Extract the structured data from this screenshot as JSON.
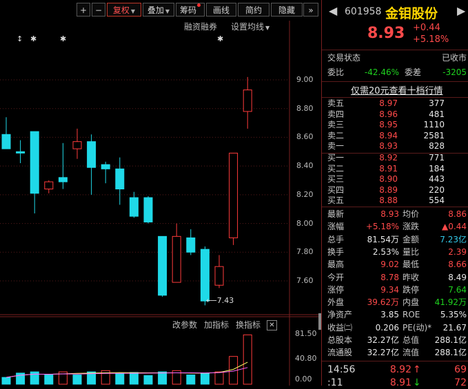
{
  "toolbar": {
    "plus": "+",
    "minus": "−",
    "fuquan": "复权",
    "diejia": "叠加",
    "chouma": "筹码",
    "huaxian": "画线",
    "jianyue": "简约",
    "yincang": "隐藏",
    "more": "»"
  },
  "chart_links": {
    "margin": "融资融券",
    "ma_settings": "设置均线"
  },
  "price_axis": [
    "9.00",
    "8.80",
    "8.60",
    "8.40",
    "8.20",
    "8.00",
    "7.80",
    "7.60"
  ],
  "low_annotation": "7.43",
  "markers": [
    "↕",
    "✱",
    "✱",
    "✱"
  ],
  "indicator_links": {
    "change_params": "改参数",
    "add_indicator": "加指标",
    "switch_indicator": "换指标",
    "close": "✕"
  },
  "volume_axis": [
    "81.50",
    "40.80",
    "0.00"
  ],
  "candles": [
    {
      "o": 8.62,
      "c": 8.52,
      "h": 8.74,
      "l": 8.52
    },
    {
      "o": 8.5,
      "c": 8.49,
      "h": 8.58,
      "l": 8.42
    },
    {
      "o": 8.64,
      "c": 8.21,
      "h": 8.64,
      "l": 8.07
    },
    {
      "o": 8.24,
      "c": 8.29,
      "h": 8.3,
      "l": 8.21
    },
    {
      "o": 8.32,
      "c": 8.29,
      "h": 8.56,
      "l": 8.24
    },
    {
      "o": 8.52,
      "c": 8.57,
      "h": 8.66,
      "l": 8.45
    },
    {
      "o": 8.57,
      "c": 8.39,
      "h": 8.62,
      "l": 8.2
    },
    {
      "o": 8.41,
      "c": 8.38,
      "h": 8.43,
      "l": 8.28
    },
    {
      "o": 8.38,
      "c": 8.24,
      "h": 8.46,
      "l": 8.13
    },
    {
      "o": 8.18,
      "c": 8.05,
      "h": 8.22,
      "l": 8.04
    },
    {
      "o": 8.18,
      "c": 8.01,
      "h": 8.19,
      "l": 8.0
    },
    {
      "o": 7.91,
      "c": 7.5,
      "h": 7.91,
      "l": 7.49
    },
    {
      "o": 7.59,
      "c": 7.91,
      "h": 8.0,
      "l": 7.59
    },
    {
      "o": 7.9,
      "c": 7.8,
      "h": 7.96,
      "l": 7.78
    },
    {
      "o": 7.82,
      "c": 7.46,
      "h": 7.84,
      "l": 7.43
    },
    {
      "o": 7.57,
      "c": 7.7,
      "h": 7.78,
      "l": 7.55
    },
    {
      "o": 7.9,
      "c": 8.49,
      "h": 8.49,
      "l": 7.85
    },
    {
      "o": 8.78,
      "c": 8.93,
      "h": 9.02,
      "l": 8.66
    }
  ],
  "volume_bars": [
    {
      "v": 11,
      "up": false
    },
    {
      "v": 18,
      "up": false
    },
    {
      "v": 20,
      "up": false
    },
    {
      "v": 15,
      "up": false
    },
    {
      "v": 20,
      "up": true
    },
    {
      "v": 15,
      "up": false
    },
    {
      "v": 20,
      "up": false
    },
    {
      "v": 22,
      "up": true
    },
    {
      "v": 17,
      "up": false
    },
    {
      "v": 19,
      "up": false
    },
    {
      "v": 14,
      "up": false
    },
    {
      "v": 20,
      "up": false
    },
    {
      "v": 22,
      "up": true
    },
    {
      "v": 15,
      "up": false
    },
    {
      "v": 18,
      "up": false
    },
    {
      "v": 20,
      "up": true
    },
    {
      "v": 45,
      "up": true
    },
    {
      "v": 80,
      "up": true
    }
  ],
  "stock": {
    "code": "601958",
    "name": "金钼股份",
    "price": "8.93",
    "change": "+0.44",
    "change_pct": "+5.18%"
  },
  "status": {
    "label": "交易状态",
    "value": "已收市"
  },
  "ratio": {
    "wb_label": "委比",
    "wb_value": "-42.46%",
    "wc_label": "委差",
    "wc_value": "-3205"
  },
  "level2_link": "仅需20元查看十档行情",
  "asks": [
    {
      "label": "卖五",
      "price": "8.97",
      "vol": "377"
    },
    {
      "label": "卖四",
      "price": "8.96",
      "vol": "481"
    },
    {
      "label": "卖三",
      "price": "8.95",
      "vol": "1110"
    },
    {
      "label": "卖二",
      "price": "8.94",
      "vol": "2581"
    },
    {
      "label": "卖一",
      "price": "8.93",
      "vol": "828"
    }
  ],
  "bids": [
    {
      "label": "买一",
      "price": "8.92",
      "vol": "771"
    },
    {
      "label": "买二",
      "price": "8.91",
      "vol": "184"
    },
    {
      "label": "买三",
      "price": "8.90",
      "vol": "443"
    },
    {
      "label": "买四",
      "price": "8.89",
      "vol": "220"
    },
    {
      "label": "买五",
      "price": "8.88",
      "vol": "554"
    }
  ],
  "quote": [
    {
      "l1": "最新",
      "v1": "8.93",
      "c1": "red",
      "l2": "均价",
      "v2": "8.86",
      "c2": "red"
    },
    {
      "l1": "涨幅",
      "v1": "+5.18%",
      "c1": "red",
      "l2": "涨跌",
      "v2": "▲0.44",
      "c2": "red"
    },
    {
      "l1": "总手",
      "v1": "81.54万",
      "c1": "white",
      "l2": "金额",
      "v2": "7.23亿",
      "c2": "cyan"
    },
    {
      "l1": "换手",
      "v1": "2.53%",
      "c1": "white",
      "l2": "量比",
      "v2": "2.39",
      "c2": "red"
    },
    {
      "l1": "最高",
      "v1": "9.02",
      "c1": "red",
      "l2": "最低",
      "v2": "8.66",
      "c2": "red"
    },
    {
      "l1": "今开",
      "v1": "8.78",
      "c1": "red",
      "l2": "昨收",
      "v2": "8.49",
      "c2": "white"
    },
    {
      "l1": "涨停",
      "v1": "9.34",
      "c1": "red",
      "l2": "跌停",
      "v2": "7.64",
      "c2": "green"
    },
    {
      "l1": "外盘",
      "v1": "39.62万",
      "c1": "red",
      "l2": "内盘",
      "v2": "41.92万",
      "c2": "green"
    },
    {
      "l1": "净资产",
      "v1": "3.85",
      "c1": "white",
      "l2": "ROE",
      "v2": "5.35%",
      "c2": "white"
    },
    {
      "l1": "收益㈡",
      "v1": "0.206",
      "c1": "white",
      "l2": "PE(动)*",
      "v2": "21.67",
      "c2": "white"
    },
    {
      "l1": "总股本",
      "v1": "32.27亿",
      "c1": "white",
      "l2": "总值",
      "v2": "288.1亿",
      "c2": "white"
    },
    {
      "l1": "流通股",
      "v1": "32.27亿",
      "c1": "white",
      "l2": "流值",
      "v2": "288.1亿",
      "c2": "white"
    }
  ],
  "ticks": [
    {
      "time": "14:56",
      "price": "8.92",
      "arrow": "↑",
      "vol": "69"
    },
    {
      "time": ":11",
      "price": "8.91",
      "arrow": "↓",
      "vol": "72"
    }
  ],
  "colors": {
    "up": "#ff3b3b",
    "down": "#1fd9e8",
    "bg": "#000000",
    "grid": "#5a1b1b"
  }
}
